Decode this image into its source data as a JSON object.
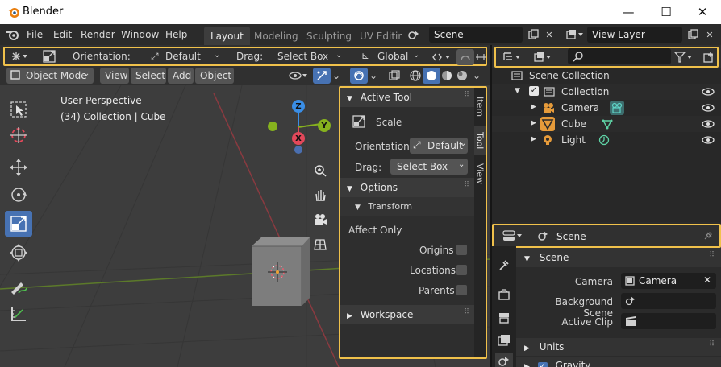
{
  "window": {
    "title": "Blender",
    "controls": {
      "minimize": "—",
      "maximize": "☐",
      "close": "✕"
    }
  },
  "topbar": {
    "menus": [
      "File",
      "Edit",
      "Render",
      "Window",
      "Help"
    ],
    "workspace_tabs": [
      "Layout",
      "Modeling",
      "Sculpting",
      "UV Editir"
    ],
    "active_workspace": "Layout",
    "scene": "Scene",
    "view_layer": "View Layer"
  },
  "tool_header": {
    "orientation_label": "Orientation:",
    "orientation_value": "Default",
    "drag_label": "Drag:",
    "drag_value": "Select Box",
    "transform_space": "Global"
  },
  "viewport_header": {
    "mode": "Object Mode",
    "menus": [
      "View",
      "Select",
      "Add",
      "Object"
    ]
  },
  "viewport": {
    "view_name": "User Perspective",
    "collection_info": "(34) Collection | Cube",
    "gizmo": {
      "z": "Z",
      "y": "Y",
      "x": "X"
    }
  },
  "npanel": {
    "active_tool_title": "Active Tool",
    "tool_name": "Scale",
    "orientation_label": "Orientation",
    "orientation_value": "Default",
    "drag_label": "Drag:",
    "drag_value": "Select Box",
    "options_title": "Options",
    "transform_title": "Transform",
    "affect_only": "Affect Only",
    "origins": "Origins",
    "locations": "Locations",
    "parents": "Parents",
    "workspace_title": "Workspace",
    "tabs": [
      "Item",
      "Tool",
      "View"
    ],
    "active_tab": "Tool"
  },
  "outliner": {
    "scene_collection": "Scene Collection",
    "items": [
      {
        "label": "Collection"
      },
      {
        "label": "Camera"
      },
      {
        "label": "Cube"
      },
      {
        "label": "Light"
      }
    ]
  },
  "properties": {
    "context": "Scene",
    "panel_title": "Scene",
    "camera_label": "Camera",
    "camera_value": "Camera",
    "background_scene_label": "Background Scene",
    "active_clip_label": "Active Clip",
    "units_title": "Units",
    "gravity_title": "Gravity"
  },
  "colors": {
    "highlight": "#f0c14b",
    "accent": "#4772b3",
    "axis_x": "#e2485a",
    "axis_y": "#86b21e",
    "axis_z": "#3a8ee6"
  }
}
